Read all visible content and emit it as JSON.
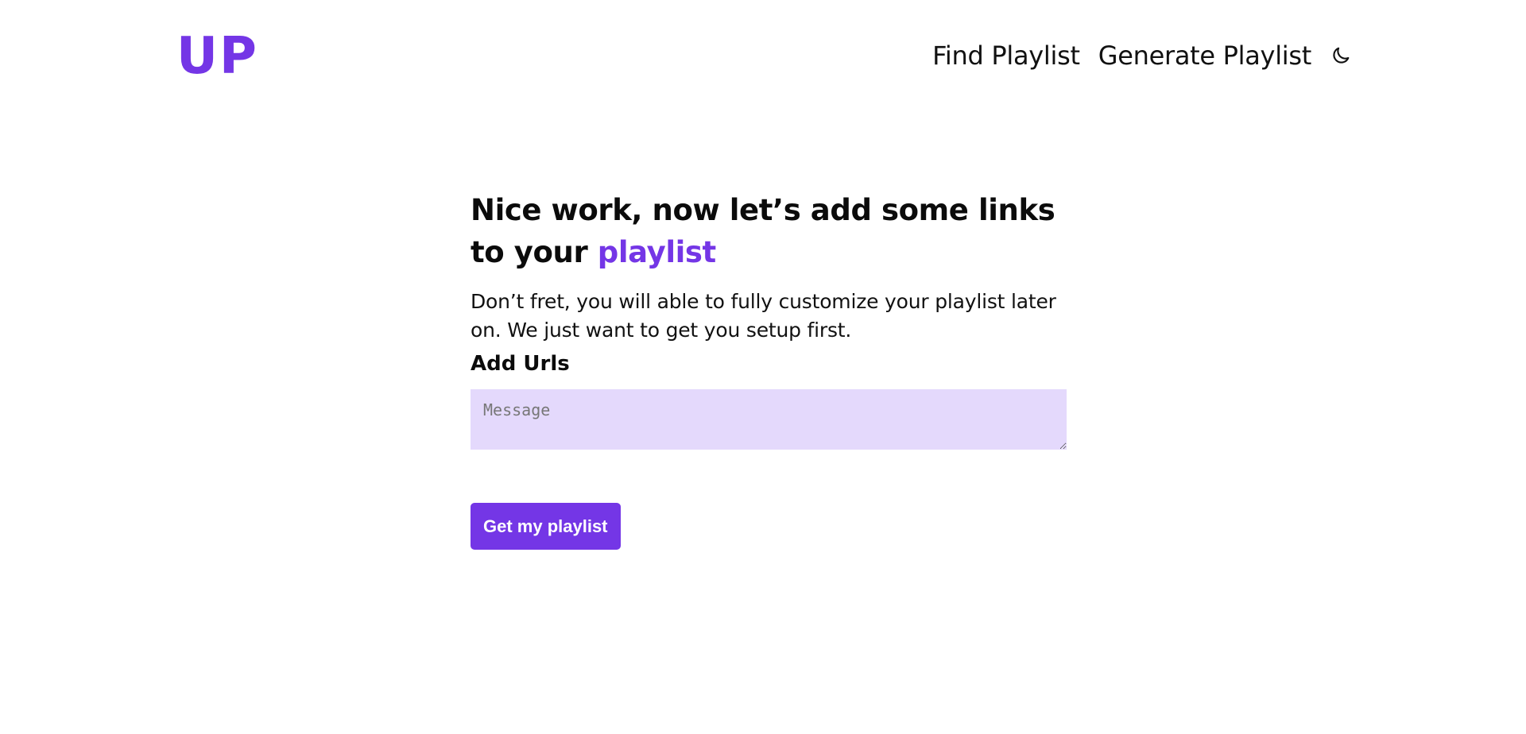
{
  "header": {
    "logo_text": "UP",
    "nav": {
      "find_playlist": "Find Playlist",
      "generate_playlist": "Generate Playlist"
    },
    "theme_toggle_icon": "moon-icon"
  },
  "main": {
    "heading_lead": "Nice work, now let’s add some links to your ",
    "heading_accent": "playlist",
    "subtext": "Don’t fret, you will able to fully customize your playlist later on. We just want to get you setup first.",
    "field_label": "Add Urls",
    "input": {
      "placeholder": "Message",
      "value": ""
    },
    "submit_label": "Get my playlist"
  },
  "colors": {
    "accent": "#7436e6",
    "input_background": "#e4d9fc",
    "text": "#111111",
    "background": "#ffffff"
  }
}
